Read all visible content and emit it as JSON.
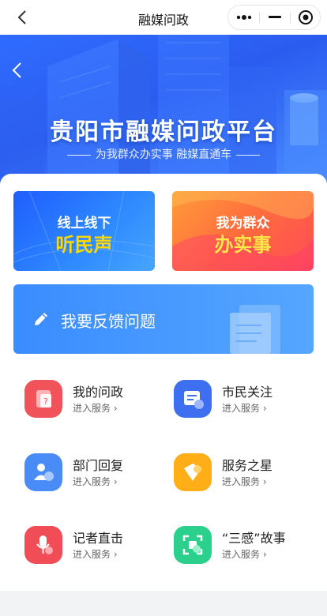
{
  "navbar": {
    "title": "融媒问政"
  },
  "banner": {
    "title": "贵阳市融媒问政平台",
    "subtitle": "为我群众办实事 融媒直通车"
  },
  "promos": [
    {
      "line1": "线上线下",
      "line2": "听民声",
      "line2_color": "#ffd800"
    },
    {
      "line1": "我为群众",
      "line2": "办实事",
      "line2_color": "#ffe74a"
    }
  ],
  "feedback": {
    "label": "我要反馈问题"
  },
  "services": [
    {
      "name": "我的问政",
      "sub": "进入服务",
      "icon": "question-doc-icon",
      "color": "#f0545a"
    },
    {
      "name": "市民关注",
      "sub": "进入服务",
      "icon": "card-heart-icon",
      "color": "#3d6ff0"
    },
    {
      "name": "部门回复",
      "sub": "进入服务",
      "icon": "user-chat-icon",
      "color": "#4a8cf7"
    },
    {
      "name": "服务之星",
      "sub": "进入服务",
      "icon": "star-badge-icon",
      "color": "#ffae17"
    },
    {
      "name": "记者直击",
      "sub": "进入服务",
      "icon": "microphone-icon",
      "color": "#f04d57"
    },
    {
      "name": "“三感”故事",
      "sub": "进入服务",
      "icon": "scan-heart-icon",
      "color": "#2ad08c"
    }
  ]
}
